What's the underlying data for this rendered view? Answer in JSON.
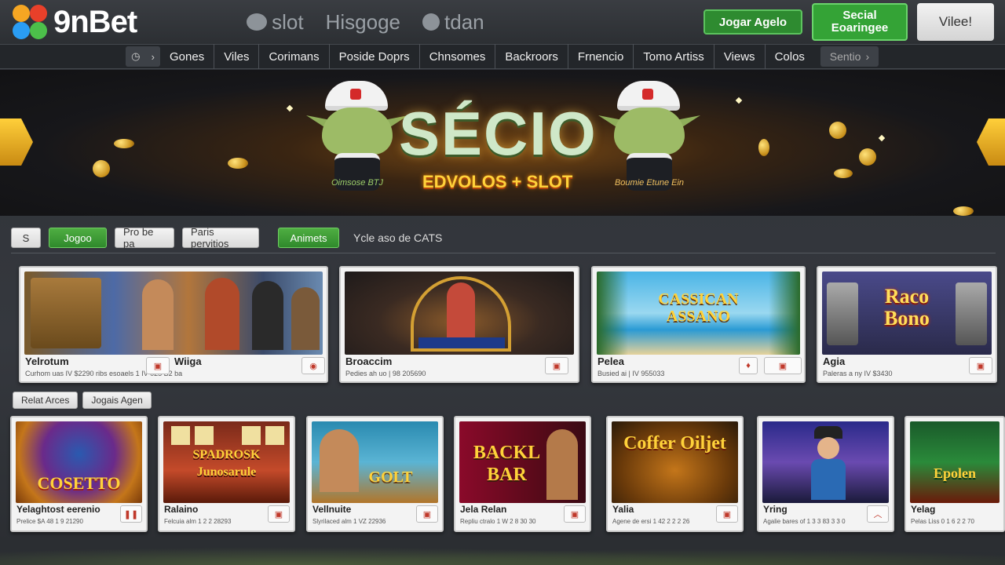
{
  "brand": {
    "name": "9nBet"
  },
  "top_nav": [
    {
      "label": "slot",
      "icon": "user-icon"
    },
    {
      "label": "Hisgoge",
      "icon": ""
    },
    {
      "label": "tdan",
      "icon": "gear-icon"
    }
  ],
  "header_actions": {
    "login": "Jogar Agelo",
    "register": "Secial Eoaringee",
    "vip": "Vilee!"
  },
  "categories": [
    "Gones",
    "Viles",
    "Corimans",
    "Poside Doprs",
    "Chnsomes",
    "Backroors",
    "Frnencio",
    "Tomo Artiss",
    "Views",
    "Colos"
  ],
  "categories_more": "Sentio",
  "banner": {
    "title": "SÉCIO",
    "subtitle": "EDVOLOS + SLOT",
    "left_tag": "Oimsose BTJ",
    "right_tag": "Boumie Etune Ein"
  },
  "filters": {
    "chips": [
      {
        "label": "S",
        "style": "light"
      },
      {
        "label": "Jogoo",
        "style": "green"
      },
      {
        "label": "Pro be pa",
        "style": "light"
      },
      {
        "label": "Paris pervitios",
        "style": "light"
      },
      {
        "label": "Animets",
        "style": "green"
      }
    ],
    "text": "Ycle aso de CATS"
  },
  "row1": [
    {
      "names": [
        "Yelrotum",
        "Wiiga"
      ],
      "meta": "Curhom uas IV $2290   ribs esoaels 1 IV 025 B2 ba",
      "image_label": ""
    },
    {
      "names": [
        "Broaccim"
      ],
      "meta": "Pedies ah uo | 98 205690",
      "image_label": ""
    },
    {
      "names": [
        "Pelea"
      ],
      "meta": "Busied ai | IV 955033",
      "image_label": "CASSICAN ASSANO"
    },
    {
      "names": [
        "Agia"
      ],
      "meta": "Paleras a ny IV $3430",
      "image_label": "Raco Bono"
    }
  ],
  "row2_tabs": [
    "Relat Arces",
    "Jogais Agen"
  ],
  "row2": [
    {
      "name": "Yelaghtost eerenio",
      "meta": "Prelice $A 48 1 9 21290",
      "image_label": "COSETTO"
    },
    {
      "name": "Ralaino",
      "meta": "Felcuia alm 1 2 2 28293",
      "image_label": "SPADROSK Junosarule"
    },
    {
      "name": "Vellnuite",
      "meta": "Slyrilaced alm 1 VZ 22936",
      "image_label": "GOLT"
    },
    {
      "name": "Jela Relan",
      "meta": "Repliu ctralo 1 W 2 8 30 30",
      "image_label": "BACKL BAR"
    },
    {
      "name": "Yalia",
      "meta": "Agene de ersi 1 42 2 2 2 26",
      "image_label": "Coffer Oiljet"
    },
    {
      "name": "Yring",
      "meta": "Agalie bares of 1 3 3 83 3 3 0",
      "image_label": ""
    },
    {
      "name": "Yelag",
      "meta": "Pelas Liss 0 1 6 2 2 70",
      "image_label": "Epolen"
    }
  ],
  "colors": {
    "accent_green": "#34a336",
    "background": "#2e3136",
    "card": "#f3f3f3"
  }
}
